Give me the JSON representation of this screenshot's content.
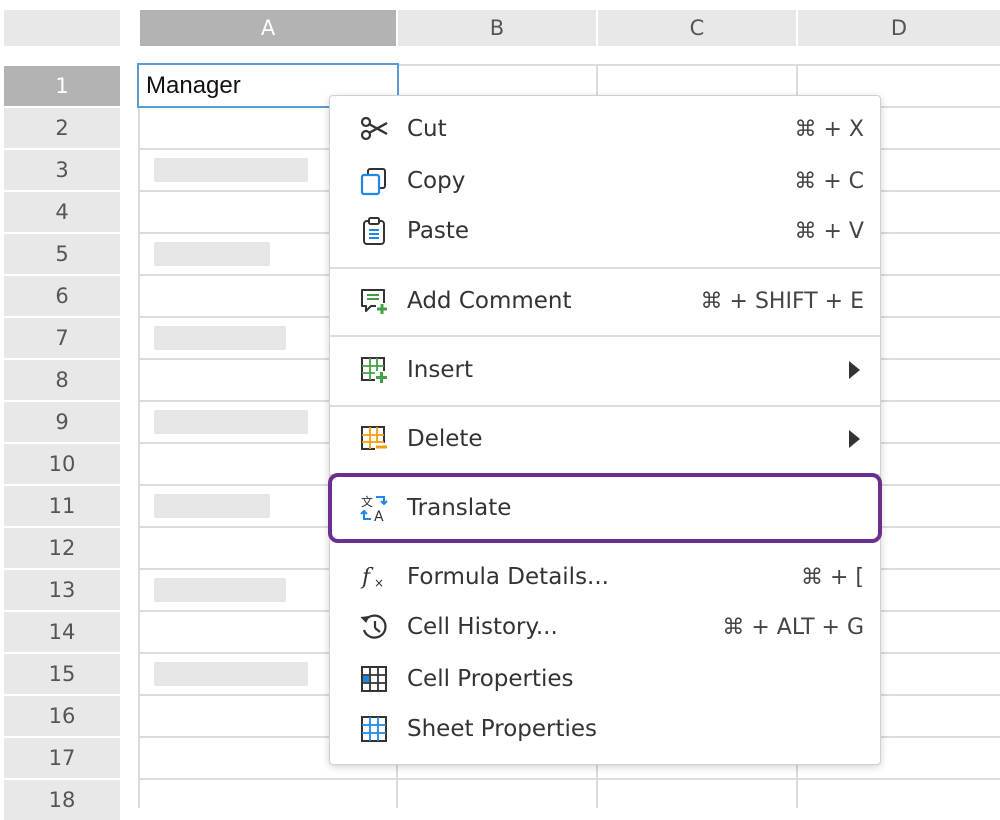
{
  "columns": [
    "A",
    "B",
    "C",
    "D"
  ],
  "rows": [
    "1",
    "2",
    "3",
    "4",
    "5",
    "6",
    "7",
    "8",
    "9",
    "10",
    "11",
    "12",
    "13",
    "14",
    "15",
    "16",
    "17",
    "18"
  ],
  "active_cell": {
    "value": "Manager"
  },
  "menu": {
    "cut": {
      "label": "Cut",
      "shortcut": "⌘ + X"
    },
    "copy": {
      "label": "Copy",
      "shortcut": "⌘ + C"
    },
    "paste": {
      "label": "Paste",
      "shortcut": "⌘ + V"
    },
    "add_comment": {
      "label": "Add Comment",
      "shortcut": "⌘ + SHIFT + E"
    },
    "insert": {
      "label": "Insert"
    },
    "delete": {
      "label": "Delete"
    },
    "translate": {
      "label": "Translate"
    },
    "formula_details": {
      "label": "Formula Details...",
      "shortcut": "⌘ + ["
    },
    "cell_history": {
      "label": "Cell History...",
      "shortcut": "⌘ + ALT + G"
    },
    "cell_properties": {
      "label": "Cell Properties"
    },
    "sheet_properties": {
      "label": "Sheet Properties"
    }
  },
  "colors": {
    "highlight": "#6b2f8f",
    "accent_blue": "#1e88e5",
    "accent_green": "#43a047",
    "accent_orange": "#f39c12"
  }
}
